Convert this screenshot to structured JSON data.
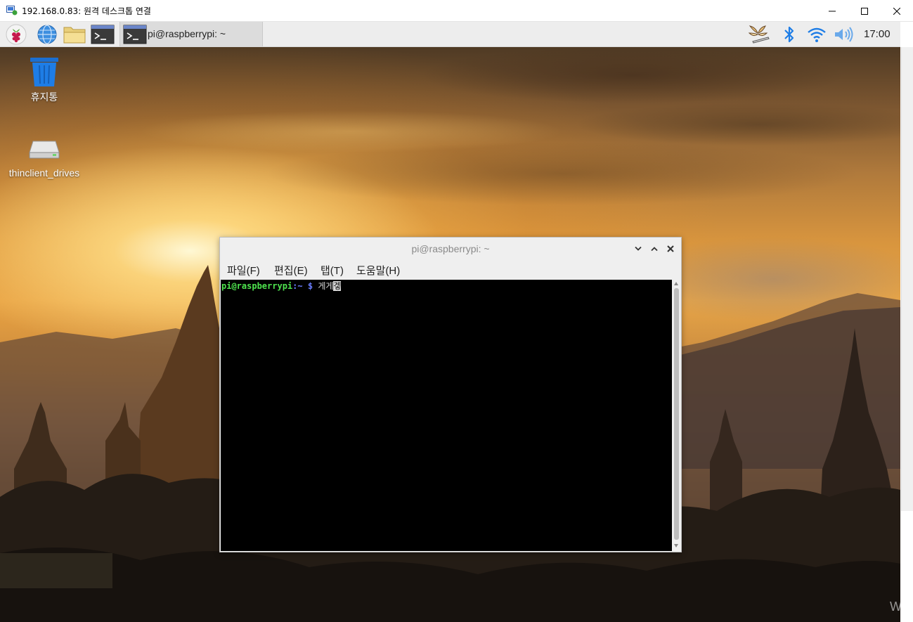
{
  "rdp_window": {
    "title": "192.168.0.83: 원격 데스크톱 연결"
  },
  "panel": {
    "launchers": [
      {
        "icon": "raspberry-menu-icon"
      },
      {
        "icon": "web-browser-icon"
      },
      {
        "icon": "file-manager-icon"
      },
      {
        "icon": "terminal-icon"
      }
    ],
    "taskbar_item": "pi@raspberrypi: ~",
    "tray_icons": [
      "vnc-butterfly-icon",
      "bluetooth-icon",
      "wifi-icon",
      "volume-icon"
    ],
    "clock": "17:00"
  },
  "desktop": {
    "icons": [
      {
        "label": "휴지통",
        "icon": "trash-icon"
      },
      {
        "label": "thinclient_drives",
        "icon": "drive-icon"
      }
    ],
    "watermark": "Wi"
  },
  "terminal": {
    "title": "pi@raspberrypi: ~",
    "menu": [
      "파일(F)",
      "편집(E)",
      "탭(T)",
      "도움말(H)"
    ],
    "prompt_user": "pi@raspberrypi",
    "prompt_sep": ":",
    "prompt_path": "~",
    "prompt_symbol": "$",
    "typed_text": "게게",
    "cursor_char": "겧"
  },
  "colors": {
    "prompt_user": "#4ee44e",
    "prompt_path": "#6a7dff",
    "terminal_bg": "#000000",
    "panel_bg": "#ededed"
  }
}
